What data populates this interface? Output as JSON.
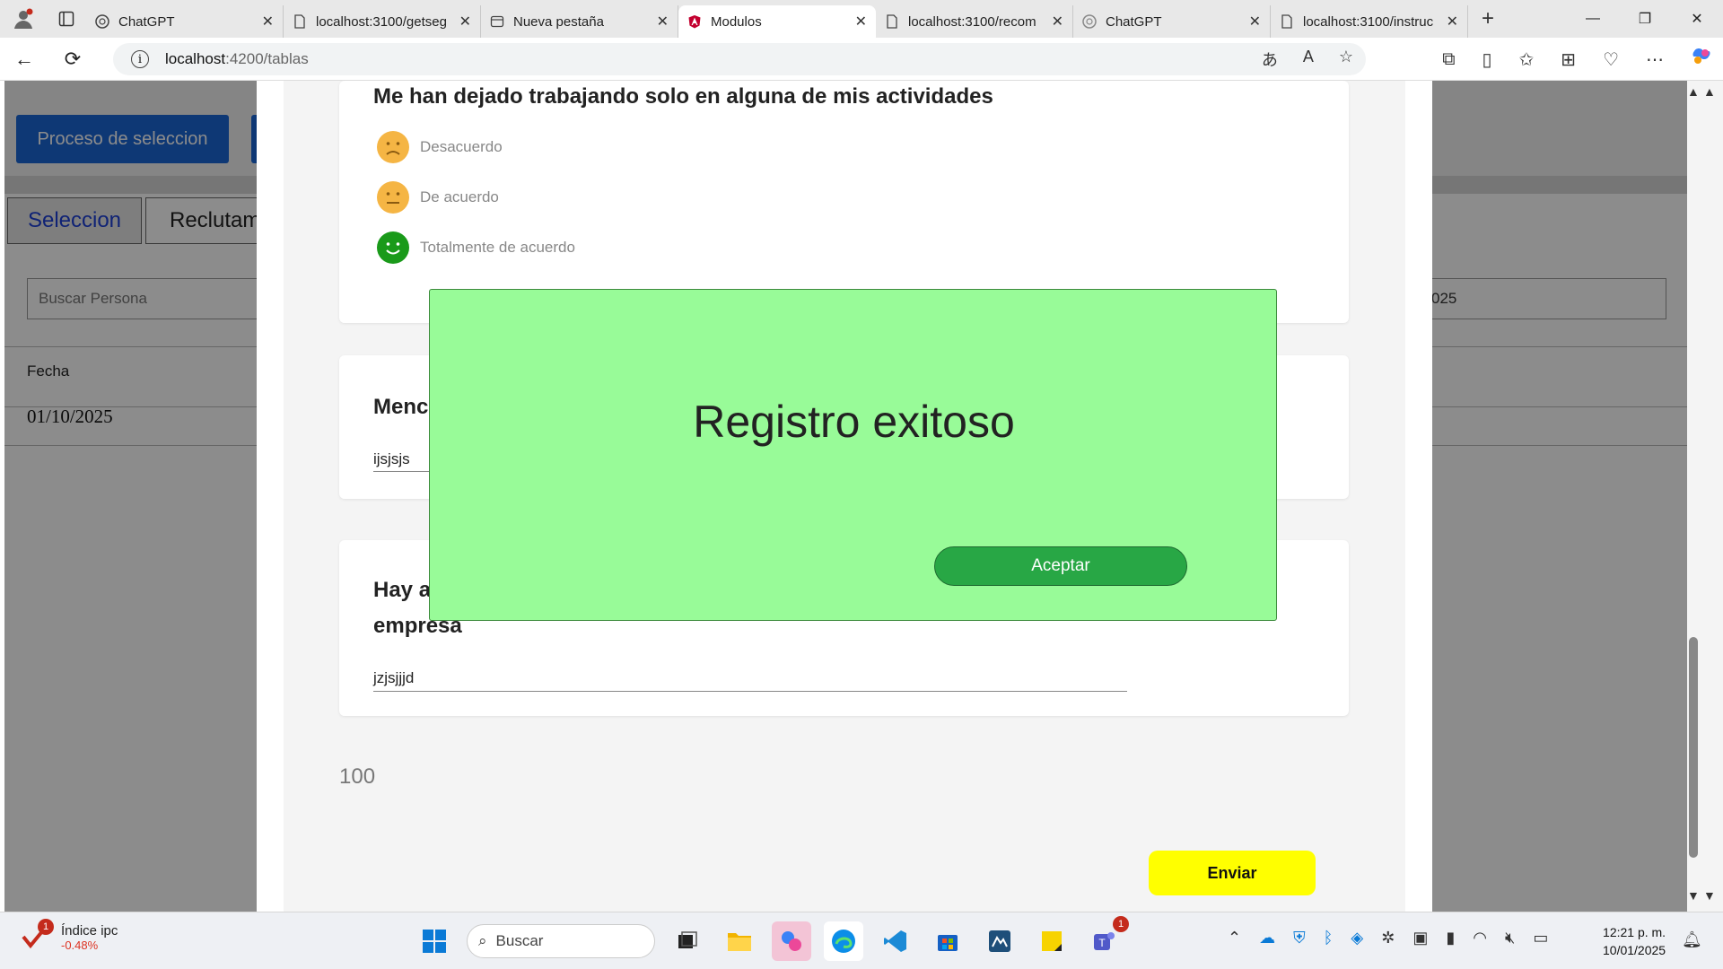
{
  "browser": {
    "tabs": [
      {
        "title": "ChatGPT",
        "icon": "chatgpt-icon"
      },
      {
        "title": "localhost:3100/getseg",
        "icon": "page-icon"
      },
      {
        "title": "Nueva pestaña",
        "icon": "newtab-icon"
      },
      {
        "title": "Modulos",
        "icon": "angular-icon",
        "active": true
      },
      {
        "title": "localhost:3100/recom",
        "icon": "page-icon"
      },
      {
        "title": "ChatGPT",
        "icon": "chatgpt-icon"
      },
      {
        "title": "localhost:3100/instruc",
        "icon": "page-icon"
      }
    ],
    "url_host": "localhost",
    "url_path": ":4200/tablas"
  },
  "background_app": {
    "proceso_button": "Proceso de seleccion",
    "tabs": {
      "seleccion": "Seleccion",
      "reclutamiento": "Reclutam"
    },
    "search_placeholder": "Buscar Persona",
    "date_filter": "025",
    "table_header_fecha": "Fecha",
    "table_row_fecha": "01/10/2025"
  },
  "form": {
    "question1": {
      "title": "Me han dejado trabajando solo en alguna de mis actividades",
      "options": [
        "Desacuerdo",
        "De acuerdo",
        "Totalmente de acuerdo"
      ]
    },
    "question2": {
      "title_partial": "Menc",
      "answer": "ijsjsjs"
    },
    "question3": {
      "title_line1_partial": "Hay a",
      "title_line2": "empresa",
      "answer": "jzjsjjjd"
    },
    "score": "100",
    "submit_label": "Enviar"
  },
  "dialog": {
    "message": "Registro exitoso",
    "accept_label": "Aceptar"
  },
  "taskbar": {
    "widget_title": "Índice ipc",
    "widget_value": "-0.48%",
    "widget_badge": "1",
    "search_label": "Buscar",
    "teams_badge": "1",
    "time": "12:21 p. m.",
    "date": "10/01/2025"
  },
  "colors": {
    "dialog_bg": "#98fb98",
    "accept_button": "#28a745",
    "submit_button": "#ffff00",
    "primary_blue": "#1a66d6"
  }
}
